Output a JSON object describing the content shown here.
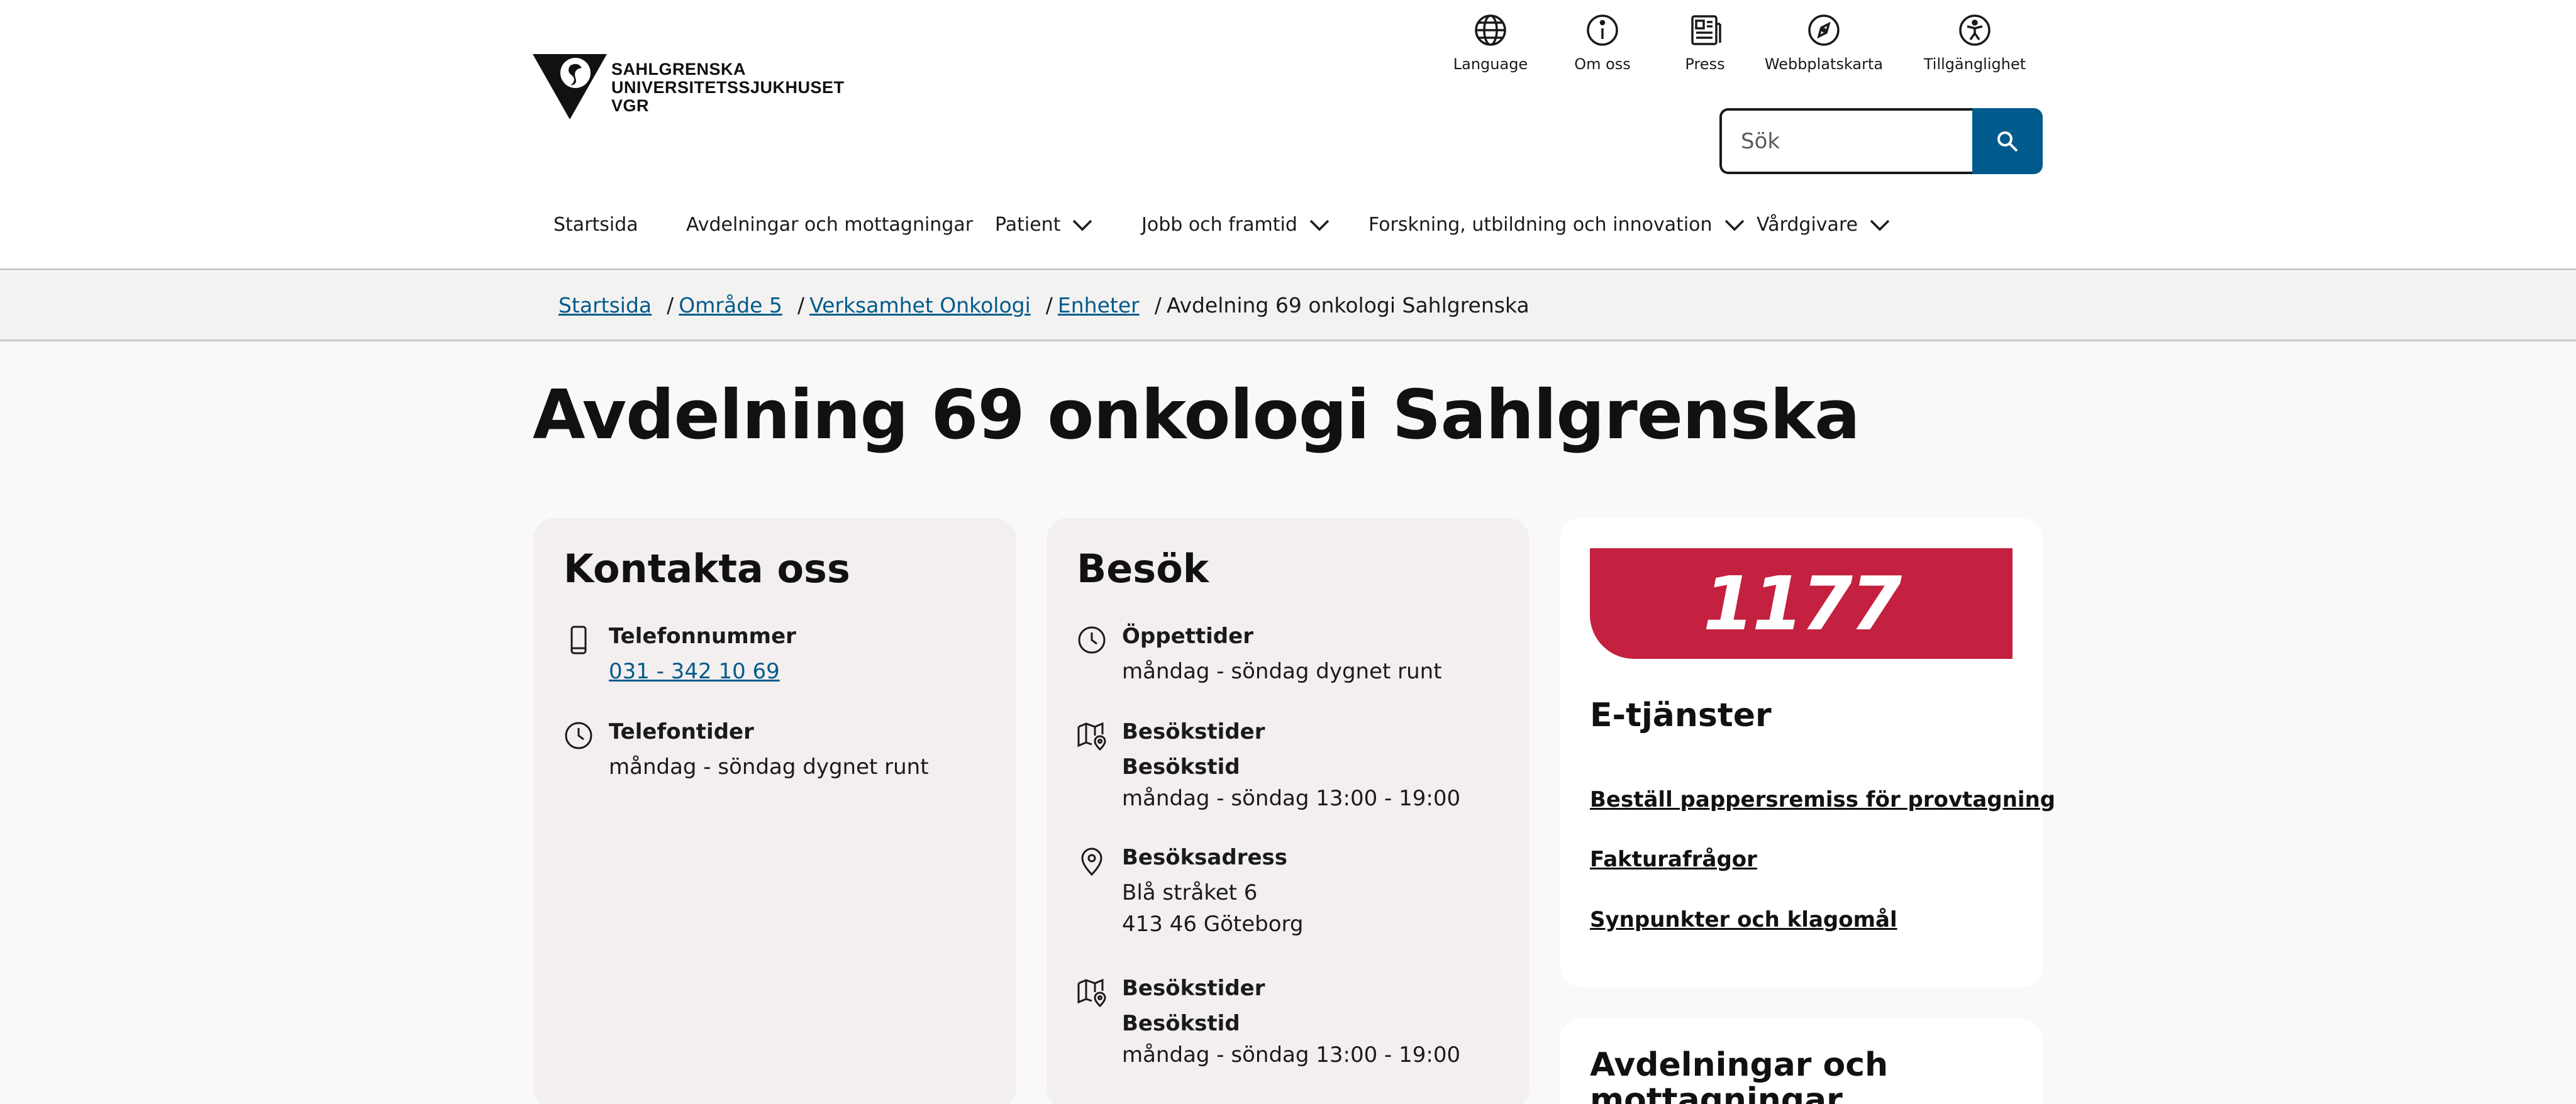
{
  "logo": {
    "line1": "SAHLGRENSKA",
    "line2": "UNIVERSITETSSJUKHUSET",
    "line3": "VGR"
  },
  "utility": [
    {
      "label": "Language",
      "icon": "globe-icon"
    },
    {
      "label": "Om oss",
      "icon": "info-icon"
    },
    {
      "label": "Press",
      "icon": "newspaper-icon"
    },
    {
      "label": "Webbplatskarta",
      "icon": "compass-icon"
    },
    {
      "label": "Tillgänglighet",
      "icon": "accessibility-icon"
    }
  ],
  "search": {
    "placeholder": "Sök",
    "icon": "search-icon"
  },
  "nav": [
    {
      "label": "Startsida"
    },
    {
      "label": "Avdelningar och mottagningar"
    },
    {
      "label": "Patient"
    },
    {
      "label": "Jobb och framtid"
    },
    {
      "label": "Forskning, utbildning och innovation"
    },
    {
      "label": "Vårdgivare"
    }
  ],
  "breadcrumb": {
    "items": [
      "Startsida",
      "Område 5",
      "Verksamhet Onkologi",
      "Enheter"
    ],
    "separator": "/",
    "current": "Avdelning 69 onkologi Sahlgrenska"
  },
  "page_title": "Avdelning 69 onkologi Sahlgrenska",
  "contact": {
    "title": "Kontakta oss",
    "phone_label": "Telefonnummer",
    "phone_value": "031 - 342 10 69",
    "hours_label": "Telefontider",
    "hours_value": "måndag - söndag dygnet runt"
  },
  "visit": {
    "title": "Besök",
    "open_label": "Öppettider",
    "open_value": "måndag - söndag dygnet runt",
    "visit1_label": "Besökstider",
    "visit1_sub": "Besökstid",
    "visit1_value": "måndag - söndag 13:00 - 19:00",
    "address_label": "Besöksadress",
    "address_line1": "Blå stråket 6",
    "address_line2": "413 46 Göteborg",
    "visit2_label": "Besökstider",
    "visit2_sub": "Besökstid",
    "visit2_value": "måndag - söndag 13:00 - 19:00"
  },
  "eservices": {
    "banner": "1177",
    "title": "E-tjänster",
    "links": [
      "Beställ pappersremiss för provtagning",
      "Fakturafrågor",
      "Synpunkter och klagomål"
    ]
  },
  "units": {
    "title_line1": "Avdelningar och",
    "title_line2": "mottagningar"
  },
  "colors": {
    "accent": "#005b8c",
    "brand_1177": "#c4203f",
    "background": "#faf9f9",
    "card_grey": "#f3efee"
  }
}
